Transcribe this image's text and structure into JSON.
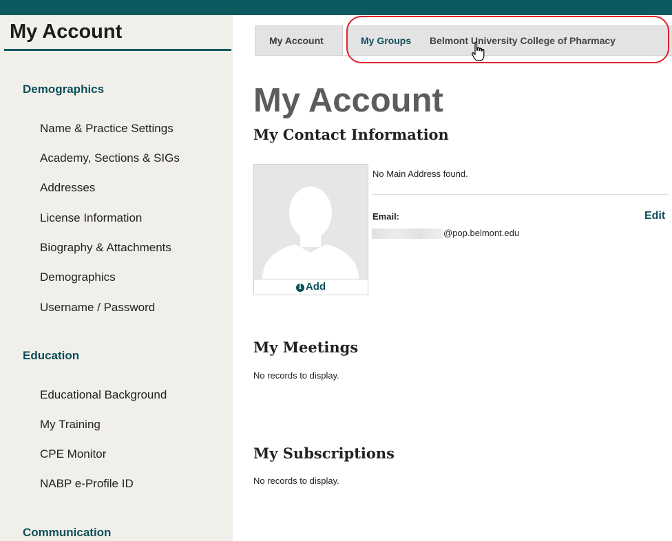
{
  "sidebar": {
    "title": "My Account",
    "sections": [
      {
        "heading": "Demographics",
        "items": [
          "Name & Practice Settings",
          "Academy, Sections & SIGs",
          "Addresses",
          "License Information",
          "Biography & Attachments",
          "Demographics",
          "Username / Password"
        ]
      },
      {
        "heading": "Education",
        "items": [
          "Educational Background",
          "My Training",
          "CPE Monitor",
          "NABP e-Profile ID"
        ]
      },
      {
        "heading": "Communication",
        "items": []
      }
    ]
  },
  "tabs": {
    "my_account": "My Account",
    "my_groups": "My Groups",
    "group_name": "Belmont University College of Pharmacy"
  },
  "main": {
    "page_title": "My Account",
    "contact_title": "My Contact Information",
    "no_address": "No Main Address found.",
    "email_label": "Email:",
    "email_value": "@pop.belmont.edu",
    "edit_label": "Edit",
    "add_photo_label": "Add",
    "meetings_title": "My Meetings",
    "meetings_empty": "No records to display.",
    "subscriptions_title": "My Subscriptions",
    "subscriptions_empty": "No records to display."
  },
  "colors": {
    "brand": "#0b5a5f",
    "link": "#0b4f5b",
    "highlight": "#e0202a",
    "sidebar_bg": "#f1efe9"
  },
  "icons": [
    "info-icon",
    "hand-pointer-cursor-icon",
    "profile-placeholder-icon"
  ]
}
